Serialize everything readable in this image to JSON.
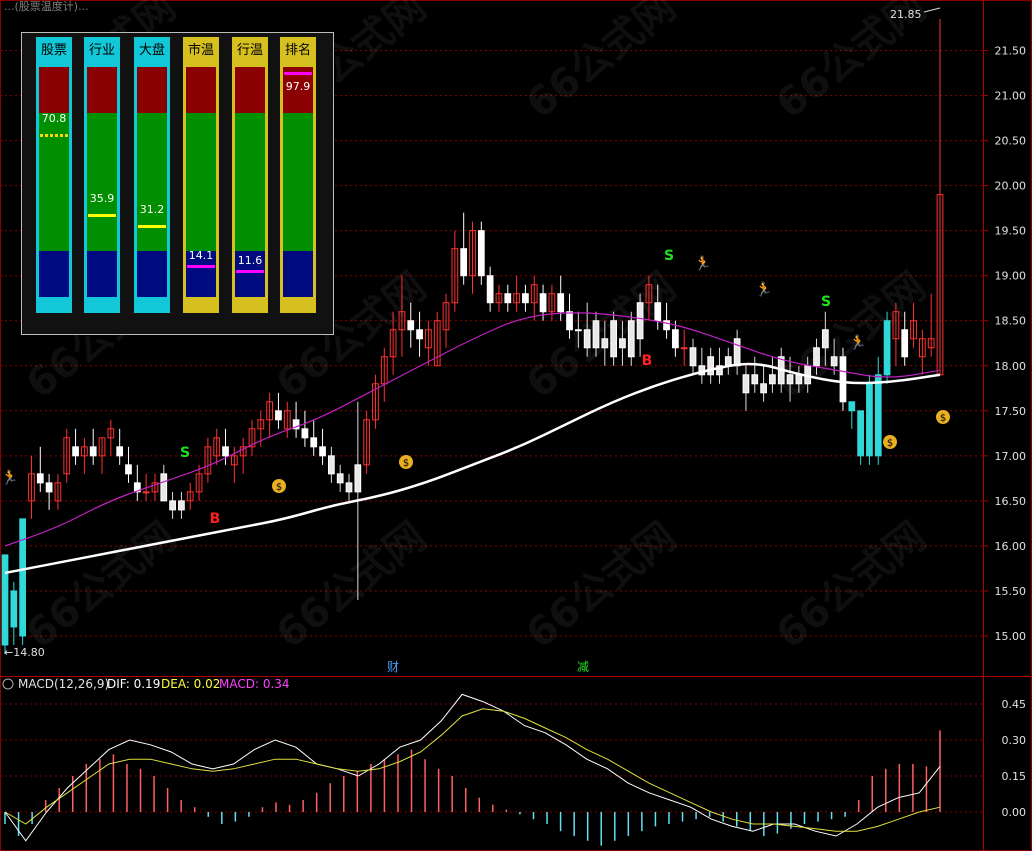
{
  "header": {
    "text": "...(股票温度计)...",
    "extra": "... ..."
  },
  "panel": {
    "columns": [
      {
        "label": "股票",
        "value": "70.8",
        "frac": 0.708,
        "marker": "#ffd700",
        "base": "#12c8d8",
        "marker_style": "dash"
      },
      {
        "label": "行业",
        "value": "35.9",
        "frac": 0.359,
        "marker": "#ffff00",
        "base": "#12c8d8",
        "marker_style": "solid"
      },
      {
        "label": "大盘",
        "value": "31.2",
        "frac": 0.312,
        "marker": "#ffff00",
        "base": "#12c8d8",
        "marker_style": "solid"
      },
      {
        "label": "市温",
        "value": "14.1",
        "frac": 0.141,
        "marker": "#ff00ff",
        "base": "#d6c020",
        "marker_style": "solid"
      },
      {
        "label": "行温",
        "value": "11.6",
        "frac": 0.116,
        "marker": "#ff00ff",
        "base": "#d6c020",
        "marker_style": "solid"
      },
      {
        "label": "排名",
        "value": "97.9",
        "frac": 0.979,
        "marker": "#ff00ff",
        "base": "#d6c020",
        "marker_style": "solid"
      }
    ]
  },
  "price_axis": {
    "ticks": [
      "21.50",
      "21.00",
      "20.50",
      "20.00",
      "19.50",
      "19.00",
      "18.50",
      "18.00",
      "17.50",
      "17.00",
      "16.50",
      "16.00",
      "15.50",
      "15.00"
    ],
    "max_label": "21.85",
    "min_label": "14.80"
  },
  "markers": {
    "event1": "财",
    "event2": "减",
    "buy": "B",
    "sell": "S"
  },
  "macd": {
    "title": "MACD(12,26,9)",
    "dif": "DIF: 0.19",
    "dea": "DEA: 0.02",
    "macd": "MACD: 0.34",
    "ticks": [
      "0.45",
      "0.30",
      "0.15",
      "0.00"
    ]
  },
  "colors": {
    "up": "#ff3030",
    "down": "#ffffff",
    "cyan": "#30d8d8",
    "ma_white": "#ffffff",
    "ma_purple": "#c020c0",
    "grid": "#8a0000"
  },
  "watermark": "66公式网",
  "chart_data": {
    "type": "candlestick",
    "ylim": [
      14.6,
      21.95
    ],
    "series": [
      {
        "name": "K",
        "ohlc": [
          [
            15.9,
            15.9,
            14.8,
            14.9
          ],
          [
            15.5,
            15.6,
            14.9,
            15.1
          ],
          [
            15.0,
            16.3,
            14.9,
            16.3
          ],
          [
            16.5,
            17.0,
            16.3,
            16.8
          ],
          [
            16.8,
            17.1,
            16.6,
            16.7
          ],
          [
            16.7,
            16.8,
            16.4,
            16.6
          ],
          [
            16.5,
            16.8,
            16.4,
            16.7
          ],
          [
            16.8,
            17.3,
            16.7,
            17.2
          ],
          [
            17.1,
            17.3,
            16.9,
            17.0
          ],
          [
            17.0,
            17.2,
            16.8,
            17.1
          ],
          [
            17.1,
            17.3,
            16.9,
            17.0
          ],
          [
            17.0,
            17.2,
            16.8,
            17.2
          ],
          [
            17.2,
            17.4,
            17.0,
            17.3
          ],
          [
            17.1,
            17.3,
            16.9,
            17.0
          ],
          [
            16.9,
            17.1,
            16.7,
            16.8
          ],
          [
            16.7,
            16.9,
            16.5,
            16.6
          ],
          [
            16.6,
            16.8,
            16.5,
            16.6
          ],
          [
            16.6,
            16.8,
            16.5,
            16.7
          ],
          [
            16.8,
            16.9,
            16.5,
            16.5
          ],
          [
            16.5,
            16.6,
            16.3,
            16.4
          ],
          [
            16.4,
            16.6,
            16.3,
            16.5
          ],
          [
            16.5,
            16.7,
            16.4,
            16.6
          ],
          [
            16.6,
            16.9,
            16.5,
            16.8
          ],
          [
            16.8,
            17.2,
            16.7,
            17.1
          ],
          [
            17.0,
            17.3,
            16.9,
            17.2
          ],
          [
            17.1,
            17.3,
            16.9,
            17.0
          ],
          [
            16.9,
            17.1,
            16.7,
            17.0
          ],
          [
            17.0,
            17.2,
            16.8,
            17.1
          ],
          [
            17.1,
            17.4,
            17.0,
            17.3
          ],
          [
            17.3,
            17.5,
            17.1,
            17.4
          ],
          [
            17.4,
            17.7,
            17.2,
            17.6
          ],
          [
            17.5,
            17.7,
            17.3,
            17.4
          ],
          [
            17.3,
            17.6,
            17.2,
            17.5
          ],
          [
            17.4,
            17.6,
            17.2,
            17.3
          ],
          [
            17.3,
            17.5,
            17.1,
            17.2
          ],
          [
            17.2,
            17.4,
            17.0,
            17.1
          ],
          [
            17.1,
            17.3,
            16.9,
            17.0
          ],
          [
            17.0,
            17.1,
            16.7,
            16.8
          ],
          [
            16.8,
            16.9,
            16.6,
            16.7
          ],
          [
            16.7,
            16.8,
            16.5,
            16.6
          ],
          [
            16.6,
            17.6,
            15.4,
            16.9
          ],
          [
            16.9,
            17.5,
            16.8,
            17.4
          ],
          [
            17.4,
            17.9,
            17.3,
            17.8
          ],
          [
            17.8,
            18.2,
            17.6,
            18.1
          ],
          [
            18.1,
            18.6,
            17.9,
            18.4
          ],
          [
            18.4,
            19.0,
            18.1,
            18.6
          ],
          [
            18.5,
            18.7,
            18.2,
            18.4
          ],
          [
            18.4,
            18.6,
            18.1,
            18.3
          ],
          [
            18.2,
            18.5,
            18.0,
            18.4
          ],
          [
            18.0,
            18.6,
            18.0,
            18.5
          ],
          [
            18.4,
            18.8,
            18.2,
            18.7
          ],
          [
            18.7,
            19.5,
            18.6,
            19.3
          ],
          [
            19.3,
            19.7,
            18.9,
            19.0
          ],
          [
            19.0,
            19.6,
            18.8,
            19.5
          ],
          [
            19.5,
            19.6,
            18.9,
            19.0
          ],
          [
            19.0,
            19.1,
            18.6,
            18.7
          ],
          [
            18.7,
            18.9,
            18.6,
            18.8
          ],
          [
            18.8,
            18.9,
            18.6,
            18.7
          ],
          [
            18.7,
            19.0,
            18.6,
            18.8
          ],
          [
            18.8,
            18.9,
            18.6,
            18.7
          ],
          [
            18.7,
            19.0,
            18.5,
            18.9
          ],
          [
            18.8,
            18.9,
            18.5,
            18.6
          ],
          [
            18.6,
            18.9,
            18.5,
            18.8
          ],
          [
            18.8,
            19.0,
            18.5,
            18.6
          ],
          [
            18.6,
            18.8,
            18.3,
            18.4
          ],
          [
            18.4,
            18.6,
            18.2,
            18.4
          ],
          [
            18.4,
            18.7,
            18.1,
            18.2
          ],
          [
            18.2,
            18.6,
            18.1,
            18.5
          ],
          [
            18.3,
            18.5,
            18.0,
            18.2
          ],
          [
            18.5,
            18.6,
            18.0,
            18.1
          ],
          [
            18.3,
            18.5,
            18.0,
            18.2
          ],
          [
            18.5,
            18.6,
            18.0,
            18.1
          ],
          [
            18.7,
            18.8,
            18.1,
            18.3
          ],
          [
            18.7,
            19.0,
            18.5,
            18.9
          ],
          [
            18.7,
            18.9,
            18.4,
            18.5
          ],
          [
            18.5,
            18.7,
            18.3,
            18.4
          ],
          [
            18.4,
            18.5,
            18.1,
            18.2
          ],
          [
            18.2,
            18.4,
            18.0,
            18.2
          ],
          [
            18.2,
            18.3,
            17.9,
            18.0
          ],
          [
            18.0,
            18.2,
            17.8,
            17.9
          ],
          [
            17.9,
            18.2,
            17.8,
            18.1
          ],
          [
            17.9,
            18.2,
            17.8,
            18.0
          ],
          [
            18.1,
            18.2,
            17.9,
            18.0
          ],
          [
            18.0,
            18.4,
            17.9,
            18.3
          ],
          [
            17.9,
            18.0,
            17.5,
            17.7
          ],
          [
            17.9,
            18.1,
            17.7,
            17.8
          ],
          [
            17.8,
            18.0,
            17.6,
            17.7
          ],
          [
            17.9,
            18.1,
            17.7,
            17.8
          ],
          [
            17.8,
            18.2,
            17.7,
            18.1
          ],
          [
            17.9,
            18.1,
            17.6,
            17.8
          ],
          [
            17.8,
            18.0,
            17.7,
            17.9
          ],
          [
            17.8,
            18.1,
            17.7,
            18.0
          ],
          [
            18.0,
            18.3,
            17.9,
            18.2
          ],
          [
            18.2,
            18.6,
            18.0,
            18.4
          ],
          [
            18.1,
            18.3,
            17.9,
            18.0
          ],
          [
            18.1,
            18.2,
            17.5,
            17.6
          ],
          [
            17.6,
            17.6,
            17.3,
            17.5
          ],
          [
            17.5,
            17.5,
            16.9,
            17.0
          ],
          [
            17.0,
            17.9,
            16.9,
            17.8
          ],
          [
            17.0,
            18.1,
            16.9,
            17.9
          ],
          [
            17.9,
            18.6,
            17.8,
            18.5
          ],
          [
            18.3,
            18.7,
            18.0,
            18.6
          ],
          [
            18.4,
            18.6,
            18.0,
            18.1
          ],
          [
            18.3,
            18.7,
            18.2,
            18.5
          ],
          [
            18.1,
            18.4,
            17.9,
            18.3
          ],
          [
            18.2,
            18.8,
            18.1,
            18.3
          ],
          [
            17.9,
            21.85,
            17.9,
            19.9
          ]
        ]
      },
      {
        "name": "MA white",
        "values": [
          15.7,
          15.8,
          15.9,
          16.0,
          16.1,
          16.2,
          16.3,
          16.45,
          16.55,
          16.7,
          16.9,
          17.1,
          17.35,
          17.6,
          17.8,
          17.95,
          18.05,
          17.9,
          17.8,
          17.82,
          17.9
        ]
      },
      {
        "name": "MA purple",
        "values": [
          16.0,
          16.2,
          16.5,
          16.7,
          16.9,
          17.2,
          17.4,
          17.7,
          18.0,
          18.3,
          18.55,
          18.6,
          18.55,
          18.45,
          18.25,
          18.05,
          17.95,
          17.85,
          17.95
        ]
      }
    ]
  }
}
